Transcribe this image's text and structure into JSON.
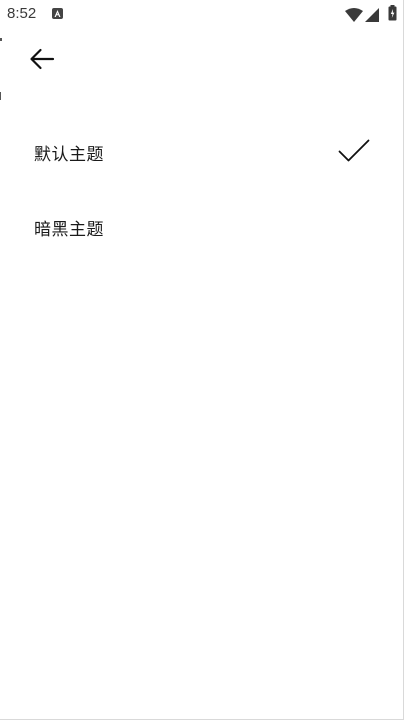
{
  "status_bar": {
    "time": "8:52",
    "icons": [
      "notification-a-icon",
      "wifi-icon",
      "signal-icon",
      "battery-icon"
    ]
  },
  "app_bar": {
    "back_icon": "arrow-left-icon"
  },
  "themes": [
    {
      "label": "默认主题",
      "selected": true
    },
    {
      "label": "暗黑主题",
      "selected": false
    }
  ],
  "colors": {
    "text": "#1a1a1a",
    "background": "#ffffff",
    "icon": "#111111"
  }
}
